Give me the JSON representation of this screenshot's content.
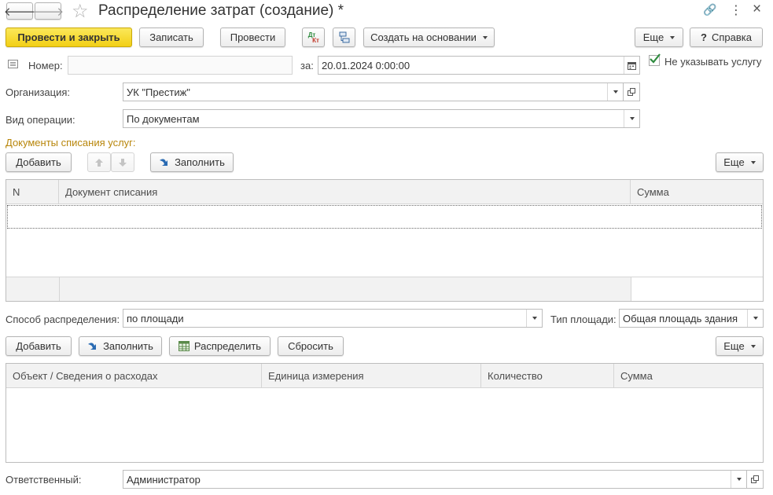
{
  "window": {
    "title": "Распределение затрат (создание) *",
    "back_glyph": "🡐",
    "forward_glyph": "🡒",
    "star_glyph": "☆",
    "link_glyph": "🔗",
    "more_glyph": "⋮",
    "close_glyph": "×"
  },
  "toolbar": {
    "post_and_close": "Провести и закрыть",
    "save": "Записать",
    "post": "Провести",
    "dt_kt_top": "Дт",
    "dt_kt_bottom": "Кт",
    "create_based_on": "Создать на основании",
    "more": "Еще",
    "help_mark": "?",
    "help": "Справка"
  },
  "header": {
    "number_label": "Номер:",
    "number_value": "",
    "date_label": "за:",
    "date_value": "20.01.2024  0:00:00",
    "no_service_label": "Не указывать услугу",
    "no_service_checked": true,
    "org_label": "Организация:",
    "org_value": "УК \"Престиж\"",
    "op_label": "Вид операции:",
    "op_value": "По документам"
  },
  "docs_section": {
    "title": "Документы списания услуг:",
    "add": "Добавить",
    "fill": "Заполнить",
    "more": "Еще",
    "columns": [
      "N",
      "Документ списания",
      "Сумма"
    ]
  },
  "distribution": {
    "method_label": "Способ распределения:",
    "method_value": "по площади",
    "area_type_label": "Тип площади:",
    "area_type_value": "Общая площадь здания"
  },
  "costs_section": {
    "add": "Добавить",
    "fill": "Заполнить",
    "distribute": "Распределить",
    "reset": "Сбросить",
    "more": "Еще",
    "columns": [
      "Объект / Сведения о расходах",
      "Единица измерения",
      "Количество",
      "Сумма"
    ]
  },
  "footer": {
    "responsible_label": "Ответственный:",
    "responsible_value": "Администратор"
  },
  "colors": {
    "primary_button": "#f2cf16",
    "section_title": "#b8860b",
    "checkbox_check": "#2e8b3e",
    "fill_arrow": "#2a6bb3"
  }
}
